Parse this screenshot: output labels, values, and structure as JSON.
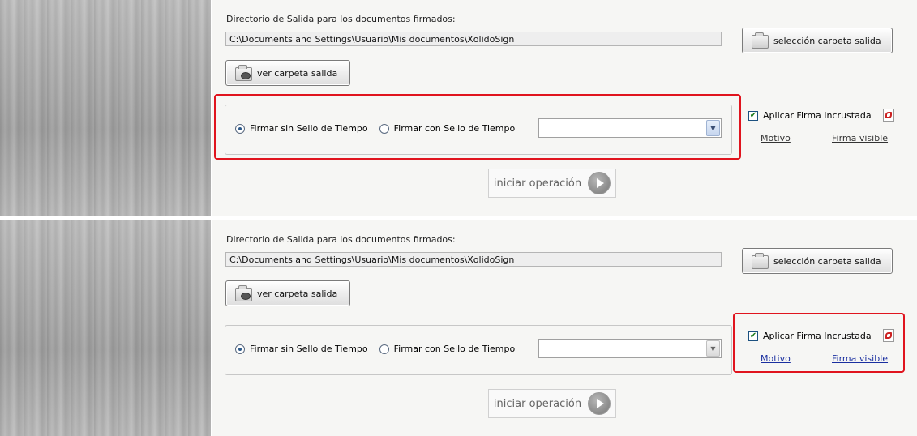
{
  "colors": {
    "highlight": "#e0141e",
    "link_bottom": "#1a2fa0"
  },
  "panels": [
    {
      "output_label": "Directorio de Salida para los documentos firmados:",
      "output_path": "C:\\Documents and Settings\\Usuario\\Mis documentos\\XolidoSign",
      "select_folder_label": "selección carpeta salida",
      "view_folder_label": "ver carpeta salida",
      "radio_no_timestamp": "Firmar sin Sello de Tiempo",
      "radio_timestamp": "Firmar con Sello de Tiempo",
      "timestamp_combo_value": "",
      "embedded_signature_label": "Aplicar Firma Incrustada",
      "embedded_signature_checked": true,
      "motivo_link": "Motivo",
      "visible_signature_link": "Firma visible",
      "start_label": "iniciar operación"
    },
    {
      "output_label": "Directorio de Salida para los documentos firmados:",
      "output_path": "C:\\Documents and Settings\\Usuario\\Mis documentos\\XolidoSign",
      "select_folder_label": "selección carpeta salida",
      "view_folder_label": "ver carpeta salida",
      "radio_no_timestamp": "Firmar sin Sello de Tiempo",
      "radio_timestamp": "Firmar con Sello de Tiempo",
      "timestamp_combo_value": "",
      "embedded_signature_label": "Aplicar Firma Incrustada",
      "embedded_signature_checked": true,
      "motivo_link": "Motivo",
      "visible_signature_link": "Firma visible",
      "start_label": "iniciar operación"
    }
  ]
}
